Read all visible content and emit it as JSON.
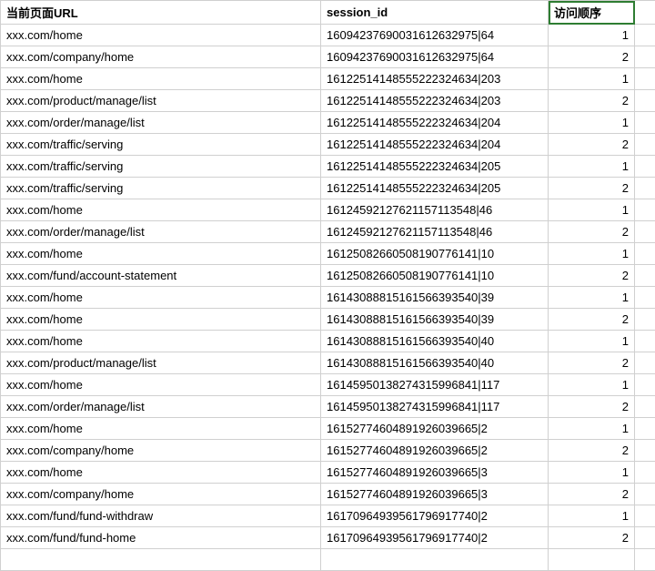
{
  "chart_data": {
    "type": "table",
    "headers": [
      "当前页面URL",
      "session_id",
      "访问顺序"
    ],
    "rows": [
      [
        "xxx.com/home",
        "16094237690031612632975|64",
        1
      ],
      [
        "xxx.com/company/home",
        "16094237690031612632975|64",
        2
      ],
      [
        "xxx.com/home",
        "16122514148555222324634|203",
        1
      ],
      [
        "xxx.com/product/manage/list",
        "16122514148555222324634|203",
        2
      ],
      [
        "xxx.com/order/manage/list",
        "16122514148555222324634|204",
        1
      ],
      [
        "xxx.com/traffic/serving",
        "16122514148555222324634|204",
        2
      ],
      [
        "xxx.com/traffic/serving",
        "16122514148555222324634|205",
        1
      ],
      [
        "xxx.com/traffic/serving",
        "16122514148555222324634|205",
        2
      ],
      [
        "xxx.com/home",
        "16124592127621157113548|46",
        1
      ],
      [
        "xxx.com/order/manage/list",
        "16124592127621157113548|46",
        2
      ],
      [
        "xxx.com/home",
        "16125082660508190776141|10",
        1
      ],
      [
        "xxx.com/fund/account-statement",
        "16125082660508190776141|10",
        2
      ],
      [
        "xxx.com/home",
        "16143088815161566393540|39",
        1
      ],
      [
        "xxx.com/home",
        "16143088815161566393540|39",
        2
      ],
      [
        "xxx.com/home",
        "16143088815161566393540|40",
        1
      ],
      [
        "xxx.com/product/manage/list",
        "16143088815161566393540|40",
        2
      ],
      [
        "xxx.com/home",
        "16145950138274315996841|117",
        1
      ],
      [
        "xxx.com/order/manage/list",
        "16145950138274315996841|117",
        2
      ],
      [
        "xxx.com/home",
        "16152774604891926039665|2",
        1
      ],
      [
        "xxx.com/company/home",
        "16152774604891926039665|2",
        2
      ],
      [
        "xxx.com/home",
        "16152774604891926039665|3",
        1
      ],
      [
        "xxx.com/company/home",
        "16152774604891926039665|3",
        2
      ],
      [
        "xxx.com/fund/fund-withdraw",
        "16170964939561796917740|2",
        1
      ],
      [
        "xxx.com/fund/fund-home",
        "16170964939561796917740|2",
        2
      ]
    ]
  }
}
